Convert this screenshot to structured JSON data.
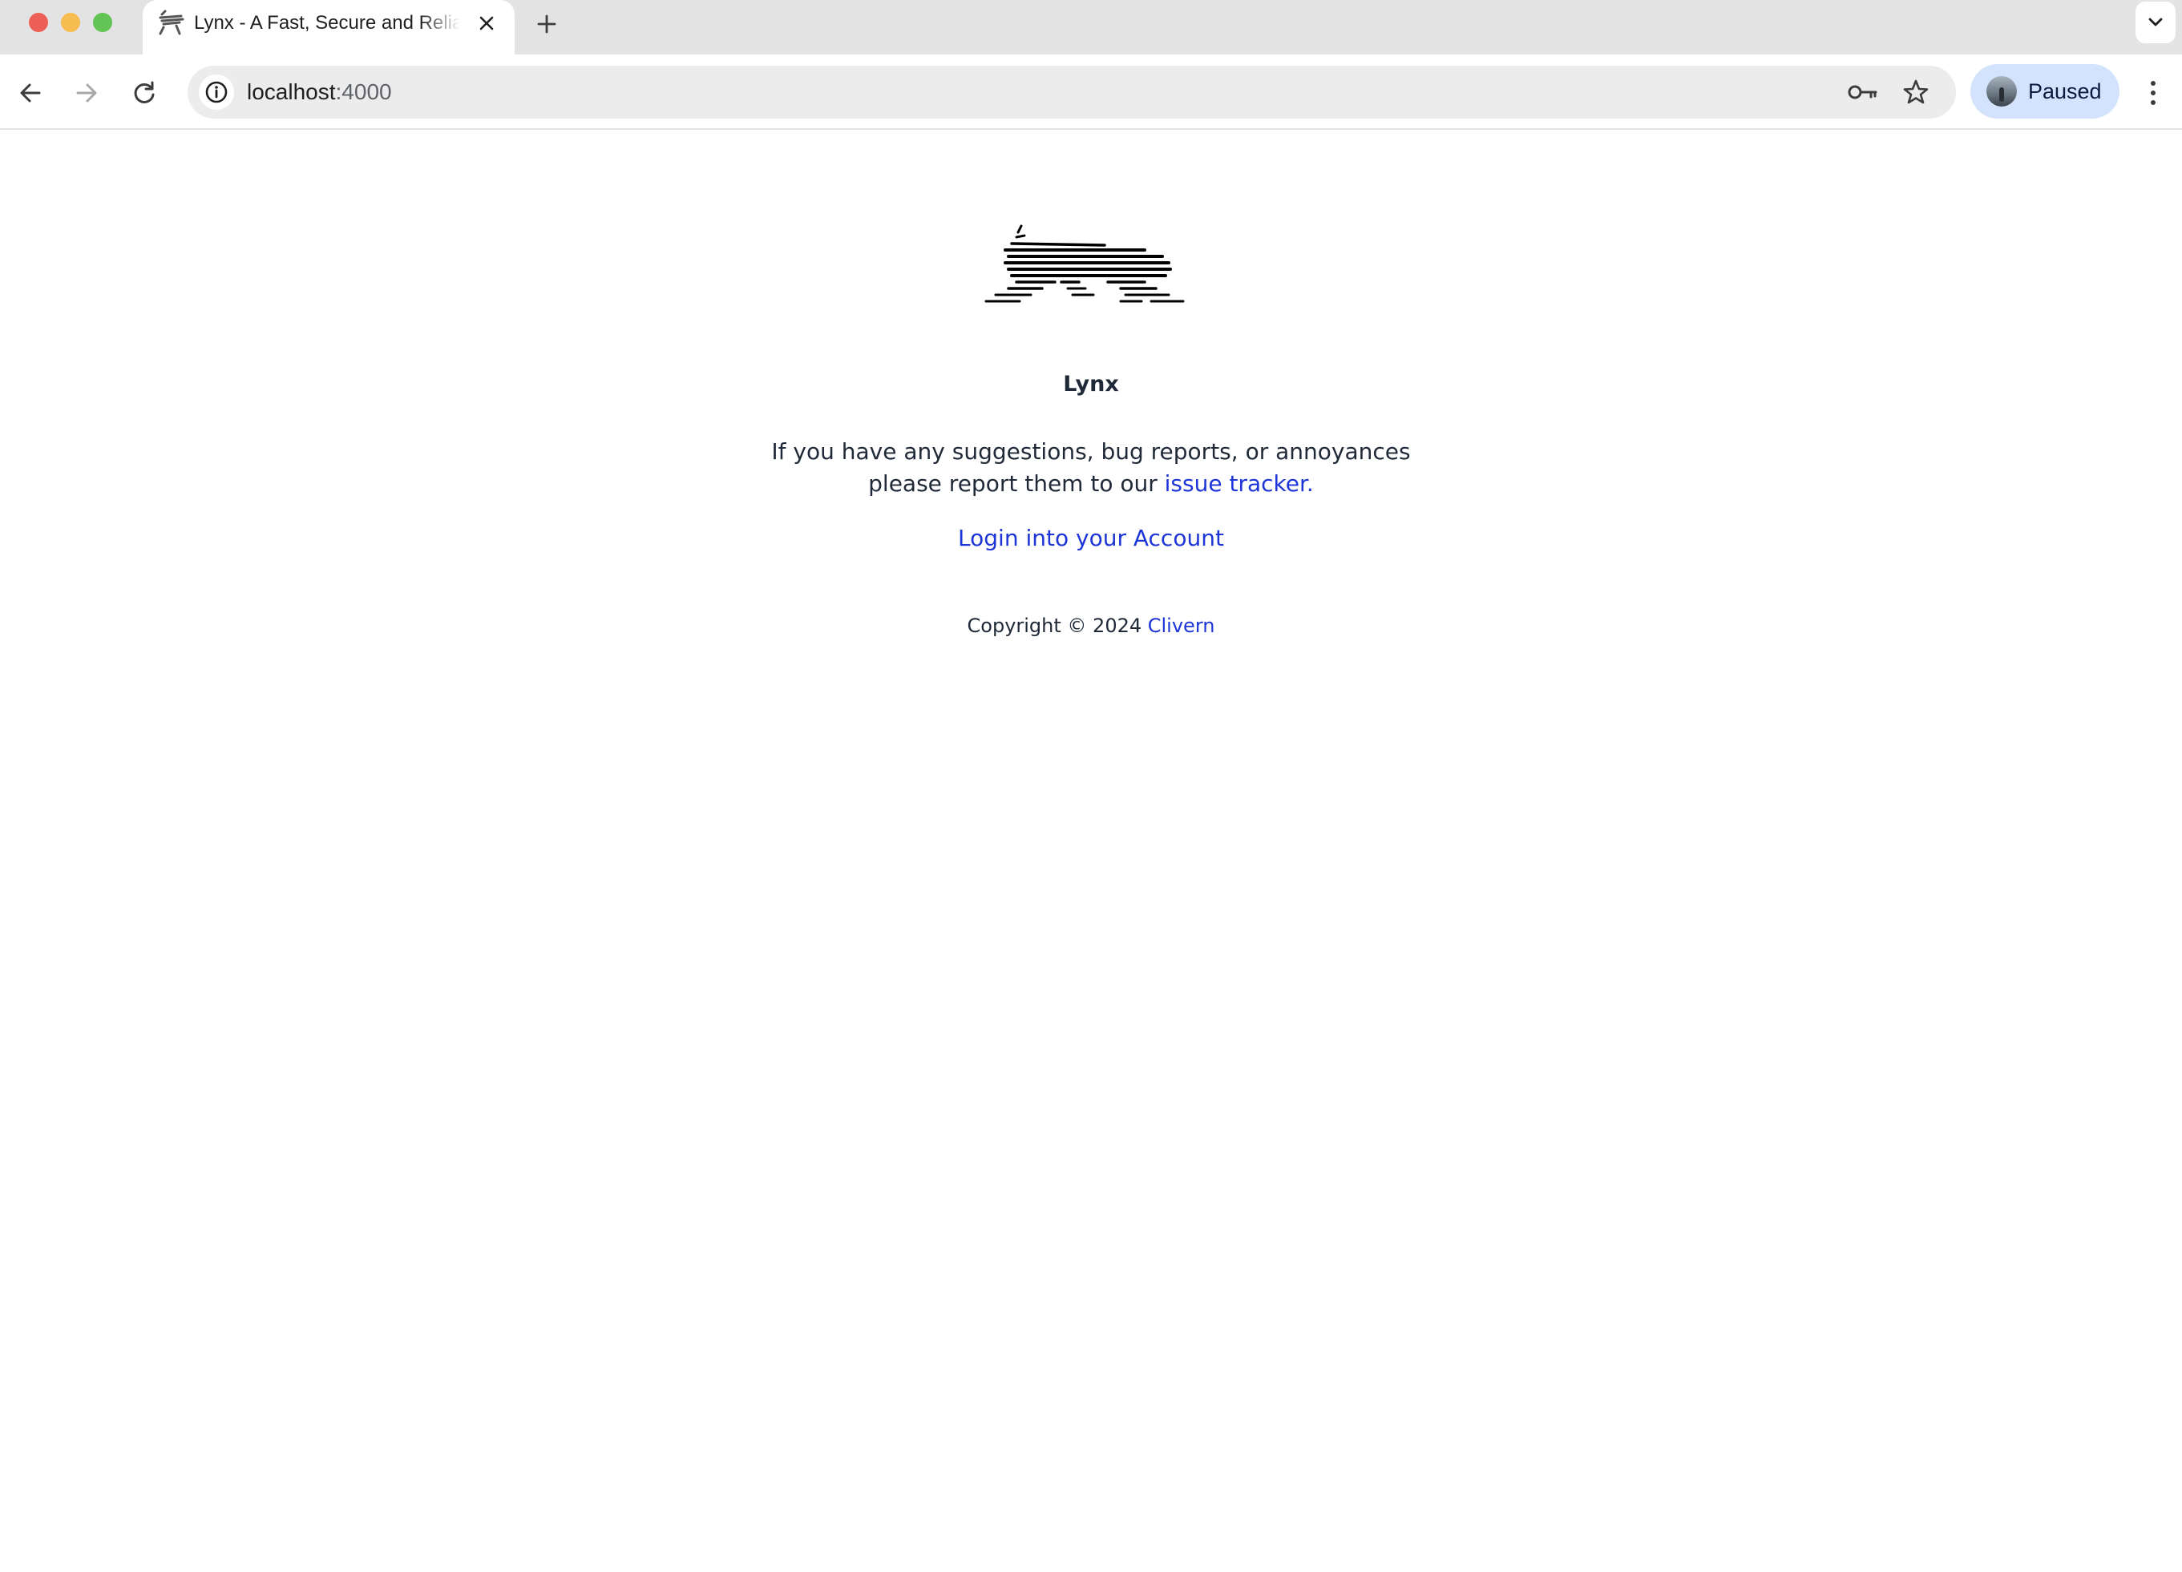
{
  "browser": {
    "tab_title": "Lynx - A Fast, Secure and Reliable",
    "new_tab_symbol": "+",
    "url_host": "localhost",
    "url_port": ":4000",
    "profile_label": "Paused",
    "icons": {
      "favicon": "lynx-favicon-icon",
      "close": "close-icon",
      "new_tab": "plus-icon",
      "tab_search": "chevron-down-icon",
      "back": "arrow-left-icon",
      "forward": "arrow-right-icon",
      "reload": "reload-icon",
      "site_info": "info-icon",
      "passwords": "key-icon",
      "bookmark": "star-icon",
      "menu": "kebab-menu-icon"
    }
  },
  "page": {
    "app_name": "Lynx",
    "message_part1": "If you have any suggestions, bug reports, or annoyances",
    "message_part2": "please report them to our ",
    "issue_link": "issue tracker",
    "message_end": ".",
    "login_link": "Login into your Account",
    "copyright_text": "Copyright © 2024 ",
    "copyright_link": "Clivern"
  },
  "colors": {
    "link": "#1d35d6",
    "text": "#1f2937",
    "profile_chip": "#d3e3fd"
  }
}
